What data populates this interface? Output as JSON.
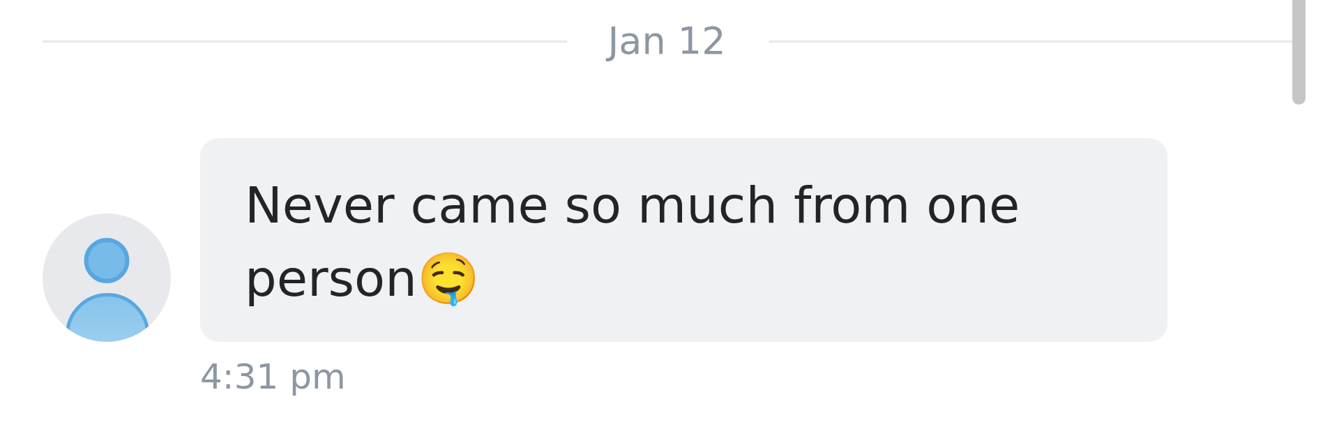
{
  "date_divider": {
    "label": "Jan 12"
  },
  "messages": [
    {
      "text": "Never came so much from one person🤤",
      "time": "4:31 pm"
    }
  ]
}
